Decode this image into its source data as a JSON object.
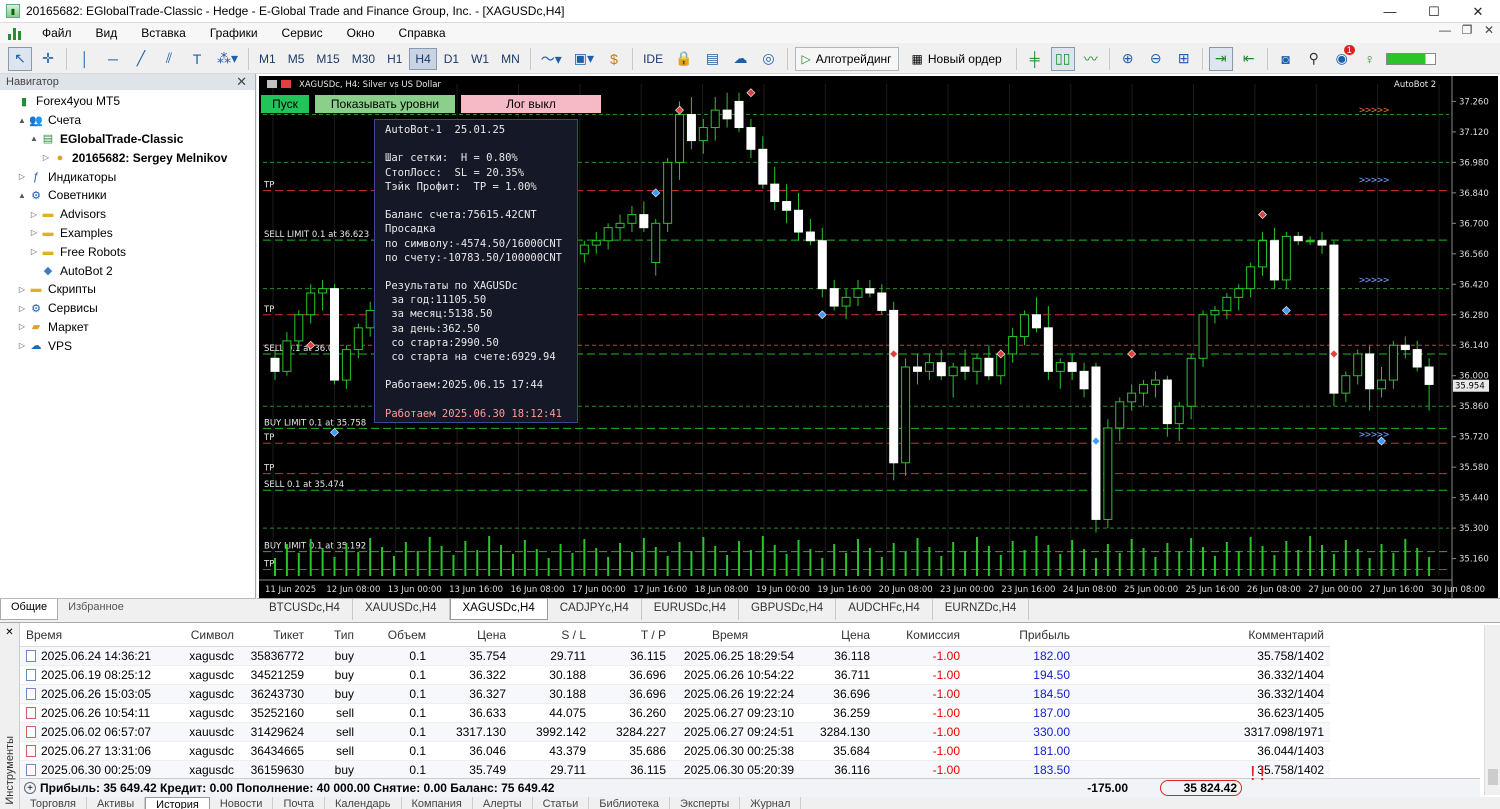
{
  "window": {
    "title": "20165682: EGlobalTrade-Classic - Hedge - E-Global Trade and Finance Group, Inc. - [XAGUSDc,H4]",
    "controls": [
      "—",
      "☐",
      "✕"
    ]
  },
  "menu": {
    "items": [
      "Файл",
      "Вид",
      "Вставка",
      "Графики",
      "Сервис",
      "Окно",
      "Справка"
    ],
    "mdi": [
      "—",
      "❐",
      "✕"
    ]
  },
  "toolbar": {
    "timeframes": [
      "M1",
      "M5",
      "M15",
      "M30",
      "H1",
      "H4",
      "D1",
      "W1",
      "MN"
    ],
    "selected_timeframe": "H4",
    "ide_label": "IDE",
    "algo_label": "Алготрейдинг",
    "new_order_label": "Новый ордер",
    "notif_count": "1"
  },
  "navigator": {
    "title": "Навигатор",
    "items": [
      {
        "label": "Forex4you MT5",
        "level": 0,
        "expander": "",
        "icon": "mt5"
      },
      {
        "label": "Счета",
        "level": 1,
        "expander": "▲",
        "icon": "accounts"
      },
      {
        "label": "EGlobalTrade-Classic",
        "level": 2,
        "expander": "▲",
        "icon": "server",
        "bold": true
      },
      {
        "label": "20165682: Sergey Melnikov",
        "level": 3,
        "expander": "▷",
        "icon": "user",
        "bold": true
      },
      {
        "label": "Индикаторы",
        "level": 1,
        "expander": "▷",
        "icon": "indicators"
      },
      {
        "label": "Советники",
        "level": 1,
        "expander": "▲",
        "icon": "experts"
      },
      {
        "label": "Advisors",
        "level": 2,
        "expander": "▷",
        "icon": "folder"
      },
      {
        "label": "Examples",
        "level": 2,
        "expander": "▷",
        "icon": "folder"
      },
      {
        "label": "Free Robots",
        "level": 2,
        "expander": "▷",
        "icon": "folder"
      },
      {
        "label": "AutoBot 2",
        "level": 2,
        "expander": "",
        "icon": "robot"
      },
      {
        "label": "Скрипты",
        "level": 1,
        "expander": "▷",
        "icon": "scripts"
      },
      {
        "label": "Сервисы",
        "level": 1,
        "expander": "▷",
        "icon": "services"
      },
      {
        "label": "Маркет",
        "level": 1,
        "expander": "▷",
        "icon": "market"
      },
      {
        "label": "VPS",
        "level": 1,
        "expander": "▷",
        "icon": "vps"
      }
    ],
    "tabs": [
      "Общие",
      "Избранное"
    ]
  },
  "chart_data": {
    "type": "candlestick",
    "symbol_label": "XAGUSDc, H4:  Silver vs US Dollar",
    "expert_label": "AutoBot 2",
    "current_price_label": "35.954",
    "ylim": [
      35.08,
      37.34
    ],
    "price_ticks": [
      "37.260",
      "37.120",
      "36.980",
      "36.840",
      "36.700",
      "36.560",
      "36.420",
      "36.280",
      "36.140",
      "36.000",
      "35.860",
      "35.720",
      "35.580",
      "35.440",
      "35.300",
      "35.160"
    ],
    "time_ticks": [
      "11 Jun 2025",
      "12 Jun 08:00",
      "13 Jun 00:00",
      "13 Jun 16:00",
      "16 Jun 08:00",
      "17 Jun 00:00",
      "17 Jun 16:00",
      "18 Jun 08:00",
      "19 Jun 00:00",
      "19 Jun 16:00",
      "20 Jun 08:00",
      "23 Jun 00:00",
      "23 Jun 16:00",
      "24 Jun 08:00",
      "25 Jun 00:00",
      "25 Jun 16:00",
      "26 Jun 08:00",
      "27 Jun 00:00",
      "27 Jun 16:00",
      "30 Jun 08:00"
    ],
    "candles": [
      [
        36.08,
        36.12,
        35.98,
        36.02
      ],
      [
        36.02,
        36.2,
        36.0,
        36.16
      ],
      [
        36.16,
        36.3,
        36.12,
        36.28
      ],
      [
        36.28,
        36.42,
        36.24,
        36.38
      ],
      [
        36.38,
        36.44,
        36.3,
        36.4
      ],
      [
        36.4,
        36.42,
        35.96,
        35.98
      ],
      [
        35.98,
        36.14,
        35.94,
        36.12
      ],
      [
        36.12,
        36.24,
        36.08,
        36.22
      ],
      [
        36.22,
        36.34,
        36.18,
        36.3
      ],
      [
        36.3,
        36.34,
        36.24,
        36.26
      ],
      [
        36.26,
        36.3,
        36.22,
        36.28
      ],
      [
        36.28,
        36.36,
        36.24,
        36.32
      ],
      [
        36.32,
        36.4,
        36.28,
        36.36
      ],
      [
        36.36,
        36.42,
        36.3,
        36.34
      ],
      [
        36.34,
        36.4,
        36.3,
        36.38
      ],
      [
        36.38,
        36.44,
        36.34,
        36.4
      ],
      [
        36.4,
        36.48,
        36.36,
        36.44
      ],
      [
        36.44,
        36.5,
        36.4,
        36.46
      ],
      [
        36.46,
        36.58,
        36.42,
        36.56
      ],
      [
        36.56,
        36.62,
        36.5,
        36.58
      ],
      [
        36.58,
        36.62,
        36.52,
        36.54
      ],
      [
        36.54,
        36.6,
        36.48,
        36.52
      ],
      [
        36.52,
        36.56,
        36.46,
        36.5
      ],
      [
        36.5,
        36.54,
        36.42,
        36.44
      ],
      [
        36.44,
        36.52,
        36.4,
        36.5
      ],
      [
        36.5,
        36.58,
        36.46,
        36.56
      ],
      [
        36.56,
        36.62,
        36.52,
        36.6
      ],
      [
        36.6,
        36.66,
        36.56,
        36.62
      ],
      [
        36.62,
        36.7,
        36.58,
        36.68
      ],
      [
        36.68,
        36.74,
        36.62,
        36.7
      ],
      [
        36.7,
        36.78,
        36.66,
        36.74
      ],
      [
        36.74,
        36.8,
        36.66,
        36.68
      ],
      [
        36.52,
        36.72,
        36.46,
        36.7
      ],
      [
        36.7,
        37.0,
        36.66,
        36.98
      ],
      [
        36.98,
        37.26,
        36.9,
        37.2
      ],
      [
        37.2,
        37.28,
        37.04,
        37.08
      ],
      [
        37.08,
        37.18,
        37.02,
        37.14
      ],
      [
        37.14,
        37.28,
        37.08,
        37.22
      ],
      [
        37.22,
        37.3,
        37.14,
        37.18
      ],
      [
        37.26,
        37.3,
        37.12,
        37.14
      ],
      [
        37.14,
        37.18,
        37.0,
        37.04
      ],
      [
        37.04,
        37.1,
        36.86,
        36.88
      ],
      [
        36.88,
        36.96,
        36.76,
        36.8
      ],
      [
        36.8,
        36.88,
        36.7,
        36.76
      ],
      [
        36.76,
        36.84,
        36.62,
        36.66
      ],
      [
        36.66,
        36.72,
        36.6,
        36.62
      ],
      [
        36.62,
        36.68,
        36.36,
        36.4
      ],
      [
        36.4,
        36.44,
        36.3,
        36.32
      ],
      [
        36.32,
        36.4,
        36.26,
        36.36
      ],
      [
        36.36,
        36.44,
        36.32,
        36.4
      ],
      [
        36.4,
        36.44,
        36.36,
        36.38
      ],
      [
        36.38,
        36.42,
        36.28,
        36.3
      ],
      [
        36.3,
        36.34,
        35.52,
        35.6
      ],
      [
        35.6,
        36.08,
        35.54,
        36.04
      ],
      [
        36.04,
        36.1,
        35.96,
        36.02
      ],
      [
        36.02,
        36.1,
        35.98,
        36.06
      ],
      [
        36.06,
        36.12,
        35.98,
        36.0
      ],
      [
        36.0,
        36.06,
        35.9,
        36.04
      ],
      [
        36.04,
        36.12,
        35.98,
        36.02
      ],
      [
        36.02,
        36.1,
        35.96,
        36.08
      ],
      [
        36.08,
        36.14,
        35.98,
        36.0
      ],
      [
        36.0,
        36.12,
        35.96,
        36.1
      ],
      [
        36.1,
        36.22,
        36.06,
        36.18
      ],
      [
        36.18,
        36.3,
        36.14,
        36.28
      ],
      [
        36.28,
        36.36,
        36.2,
        36.22
      ],
      [
        36.22,
        36.32,
        35.98,
        36.02
      ],
      [
        36.02,
        36.08,
        35.94,
        36.06
      ],
      [
        36.06,
        36.1,
        35.98,
        36.02
      ],
      [
        36.02,
        36.06,
        35.9,
        35.94
      ],
      [
        36.04,
        36.06,
        35.28,
        35.34
      ],
      [
        35.34,
        35.8,
        35.3,
        35.76
      ],
      [
        35.76,
        35.9,
        35.7,
        35.88
      ],
      [
        35.88,
        35.96,
        35.84,
        35.92
      ],
      [
        35.92,
        35.98,
        35.86,
        35.96
      ],
      [
        35.96,
        36.02,
        35.9,
        35.98
      ],
      [
        35.98,
        36.0,
        35.72,
        35.78
      ],
      [
        35.78,
        35.88,
        35.7,
        35.86
      ],
      [
        35.86,
        36.1,
        35.8,
        36.08
      ],
      [
        36.08,
        36.3,
        36.04,
        36.28
      ],
      [
        36.28,
        36.32,
        36.24,
        36.3
      ],
      [
        36.3,
        36.38,
        36.26,
        36.36
      ],
      [
        36.36,
        36.42,
        36.3,
        36.4
      ],
      [
        36.4,
        36.52,
        36.36,
        36.5
      ],
      [
        36.5,
        36.66,
        36.46,
        36.62
      ],
      [
        36.62,
        36.68,
        36.4,
        36.44
      ],
      [
        36.44,
        36.66,
        36.4,
        36.64
      ],
      [
        36.64,
        36.66,
        36.6,
        36.62
      ],
      [
        36.62,
        36.64,
        36.6,
        36.62
      ],
      [
        36.62,
        36.66,
        36.56,
        36.6
      ],
      [
        36.6,
        36.62,
        35.86,
        35.92
      ],
      [
        35.92,
        36.02,
        35.88,
        36.0
      ],
      [
        36.0,
        36.12,
        35.96,
        36.1
      ],
      [
        36.1,
        36.14,
        35.84,
        35.94
      ],
      [
        35.94,
        36.04,
        35.9,
        35.98
      ],
      [
        35.98,
        36.16,
        35.94,
        36.14
      ],
      [
        36.14,
        36.18,
        36.08,
        36.12
      ],
      [
        36.12,
        36.16,
        36.02,
        36.04
      ],
      [
        36.04,
        36.08,
        35.84,
        35.96
      ]
    ],
    "levels": [
      {
        "label": "TP",
        "price": 36.85,
        "color": "#d03030",
        "style": "dash"
      },
      {
        "label": "SELL LIMIT 0.1 at 36.623",
        "price": 36.623,
        "color": "#1fb81f",
        "style": "dash"
      },
      {
        "label": "TP",
        "price": 36.28,
        "color": "#d03030",
        "style": "dash"
      },
      {
        "label": "SELL 0.1 at 36.0",
        "price": 36.1,
        "color": "#1fb81f",
        "style": "dash"
      },
      {
        "label": "BUY LIMIT 0.1 at 35.758",
        "price": 35.758,
        "color": "#1fb81f",
        "style": "dash"
      },
      {
        "label": "TP",
        "price": 35.69,
        "color": "#d03030",
        "style": "dash"
      },
      {
        "label": "TP",
        "price": 35.55,
        "color": "#d03030",
        "style": "dash"
      },
      {
        "label": "SELL 0.1 at 35.474",
        "price": 35.474,
        "color": "#1fb81f",
        "style": "dash"
      },
      {
        "label": "BUY LIMIT 0.1 at 35.192",
        "price": 35.192,
        "color": "#1fb81f",
        "style": "dash"
      },
      {
        "label": "TP",
        "price": 35.11,
        "color": "#d03030",
        "style": "dash"
      }
    ],
    "extra_lines": [
      {
        "price": 37.2,
        "color": "#2a8a2a"
      },
      {
        "price": 36.98,
        "color": "#2a8a2a"
      },
      {
        "price": 36.4,
        "color": "#2a8a2a"
      },
      {
        "price": 36.14,
        "color": "#c04040"
      },
      {
        "price": 35.86,
        "color": "#2a8a2a"
      },
      {
        "price": 35.3,
        "color": "#2a8a2a"
      }
    ],
    "arrows_right": [
      {
        "price": 37.22,
        "color": "#e07030",
        "text": ">>>>>"
      },
      {
        "price": 36.9,
        "color": "#70a0ff",
        "text": ">>>>>"
      },
      {
        "price": 36.44,
        "color": "#70a0ff",
        "text": ">>>>>"
      },
      {
        "price": 35.73,
        "color": "#70a0ff",
        "text": ">>>>>"
      }
    ],
    "buttons": [
      {
        "label": "Пуск",
        "bg": "#22c45a",
        "color": "#000",
        "width": 48
      },
      {
        "label": "Показывать уровни",
        "bg": "#8ad08a",
        "color": "#000",
        "width": 140
      },
      {
        "label": "Лог выкл",
        "bg": "#f6b9c6",
        "color": "#000",
        "width": 140
      }
    ]
  },
  "info_panel": [
    {
      "text": "AutoBot-1  25.01.25"
    },
    {
      "text": ""
    },
    {
      "text": "Шаг сетки:  H = 0.80%"
    },
    {
      "text": "СтопЛосс:  SL = 20.35%"
    },
    {
      "text": "Тэйк Профит:  TP = 1.00%"
    },
    {
      "text": ""
    },
    {
      "text": "Баланс счета:75615.42CNT"
    },
    {
      "text": "Просадка"
    },
    {
      "text": "по символу:-4574.50/16000CNT"
    },
    {
      "text": "по счету:-10783.50/100000CNT"
    },
    {
      "text": ""
    },
    {
      "text": "Результаты по XAGUSDc"
    },
    {
      "text": " за год:11105.50"
    },
    {
      "text": " за месяц:5138.50"
    },
    {
      "text": " за день:362.50"
    },
    {
      "text": " со старта:2990.50"
    },
    {
      "text": " со старта на счете:6929.94"
    },
    {
      "text": ""
    },
    {
      "text": "Работаем:2025.06.15 17:44"
    },
    {
      "text": ""
    },
    {
      "text": "Работаем 2025.06.30 18:12:41",
      "red": true
    }
  ],
  "chart_tabs": [
    "BTCUSDc,H4",
    "XAUUSDc,H4",
    "XAGUSDc,H4",
    "CADJPYc,H4",
    "EURUSDc,H4",
    "GBPUSDc,H4",
    "AUDCHFc,H4",
    "EURNZDc,H4"
  ],
  "active_chart_tab": "XAGUSDc,H4",
  "terminal": {
    "side_label": "Инструменты",
    "columns": [
      "Время",
      "Символ",
      "Тикет",
      "Тип",
      "Объем",
      "Цена",
      "S / L",
      "T / P",
      "Время",
      "Цена",
      "Комиссия",
      "Прибыль",
      "Комментарий"
    ],
    "rows": [
      [
        "2025.06.24 14:36:21",
        "xagusdc",
        "35836772",
        "buy",
        "0.1",
        "35.754",
        "29.711",
        "36.115",
        "2025.06.25 18:29:54",
        "36.118",
        "-1.00",
        "182.00",
        "35.758/1402"
      ],
      [
        "2025.06.19 08:25:12",
        "xagusdc",
        "34521259",
        "buy",
        "0.1",
        "36.322",
        "30.188",
        "36.696",
        "2025.06.26 10:54:22",
        "36.711",
        "-1.00",
        "194.50",
        "36.332/1404"
      ],
      [
        "2025.06.26 15:03:05",
        "xagusdc",
        "36243730",
        "buy",
        "0.1",
        "36.327",
        "30.188",
        "36.696",
        "2025.06.26 19:22:24",
        "36.696",
        "-1.00",
        "184.50",
        "36.332/1404"
      ],
      [
        "2025.06.26 10:54:11",
        "xagusdc",
        "35252160",
        "sell",
        "0.1",
        "36.633",
        "44.075",
        "36.260",
        "2025.06.27 09:23:10",
        "36.259",
        "-1.00",
        "187.00",
        "36.623/1405"
      ],
      [
        "2025.06.02 06:57:07",
        "xauusdc",
        "31429624",
        "sell",
        "0.1",
        "3317.130",
        "3992.142",
        "3284.227",
        "2025.06.27 09:24:51",
        "3284.130",
        "-1.00",
        "330.00",
        "3317.098/1971"
      ],
      [
        "2025.06.27 13:31:06",
        "xagusdc",
        "36434665",
        "sell",
        "0.1",
        "36.046",
        "43.379",
        "35.686",
        "2025.06.30 00:25:38",
        "35.684",
        "-1.00",
        "181.00",
        "36.044/1403"
      ],
      [
        "2025.06.30 00:25:09",
        "xagusdc",
        "36159630",
        "buy",
        "0.1",
        "35.749",
        "29.711",
        "36.115",
        "2025.06.30 05:20:39",
        "36.116",
        "-1.00",
        "183.50",
        "35.758/1402"
      ]
    ],
    "summary": {
      "text": "Прибыль: 35 649.42  Кредит: 0.00  Пополнение: 40 000.00  Снятие: 0.00  Баланс: 75 649.42",
      "commission": "-175.00",
      "profit": "35 824.42",
      "mark": "!!"
    },
    "tabs": [
      "Торговля",
      "Активы",
      "История",
      "Новости",
      "Почта",
      "Календарь",
      "Компания",
      "Алерты",
      "Статьи",
      "Библиотека",
      "Эксперты",
      "Журнал"
    ],
    "active_tab": "История"
  }
}
